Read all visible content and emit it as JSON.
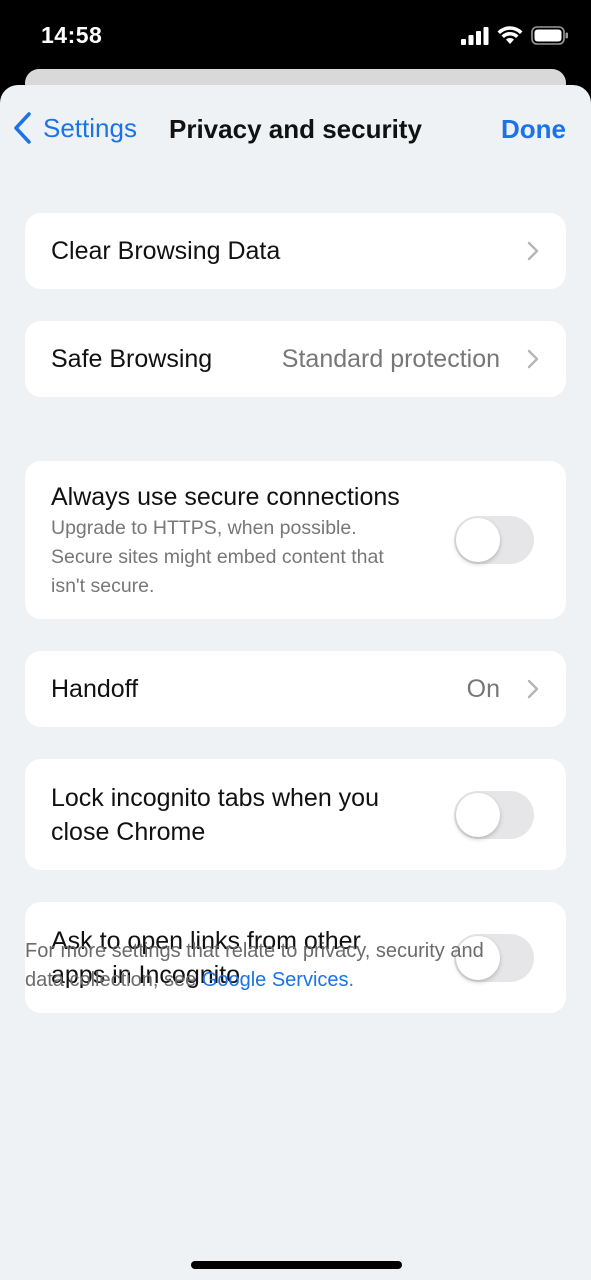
{
  "status_bar": {
    "time": "14:58",
    "icons": [
      "cellular-signal-icon",
      "wifi-icon",
      "battery-icon"
    ]
  },
  "nav": {
    "back_label": "Settings",
    "title": "Privacy and security",
    "done_label": "Done"
  },
  "rows": {
    "clear_browsing": {
      "label": "Clear Browsing Data"
    },
    "safe_browsing": {
      "label": "Safe Browsing",
      "value": "Standard protection"
    },
    "secure_connections": {
      "label": "Always use secure connections",
      "subtitle_line1": "Upgrade to HTTPS, when possible.",
      "subtitle_line2": "Secure sites might embed content that",
      "subtitle_line3": "isn't secure.",
      "enabled": false
    },
    "handoff": {
      "label": "Handoff",
      "value": "On"
    },
    "lock_incognito": {
      "label_line1": "Lock incognito tabs when you",
      "label_line2": "close Chrome",
      "enabled": false
    },
    "ask_incognito": {
      "label_line1": "Ask to open links from other",
      "label_line2": "apps in Incognito",
      "enabled": false
    }
  },
  "footer": {
    "text_line1": "For more settings that relate to privacy, security and",
    "text_prefix": "data collection, see ",
    "link": "Google Services",
    "suffix": "."
  },
  "colors": {
    "accent": "#1a73e8",
    "background": "#eef2f4",
    "card": "#ffffff",
    "secondary_text": "#777777"
  }
}
